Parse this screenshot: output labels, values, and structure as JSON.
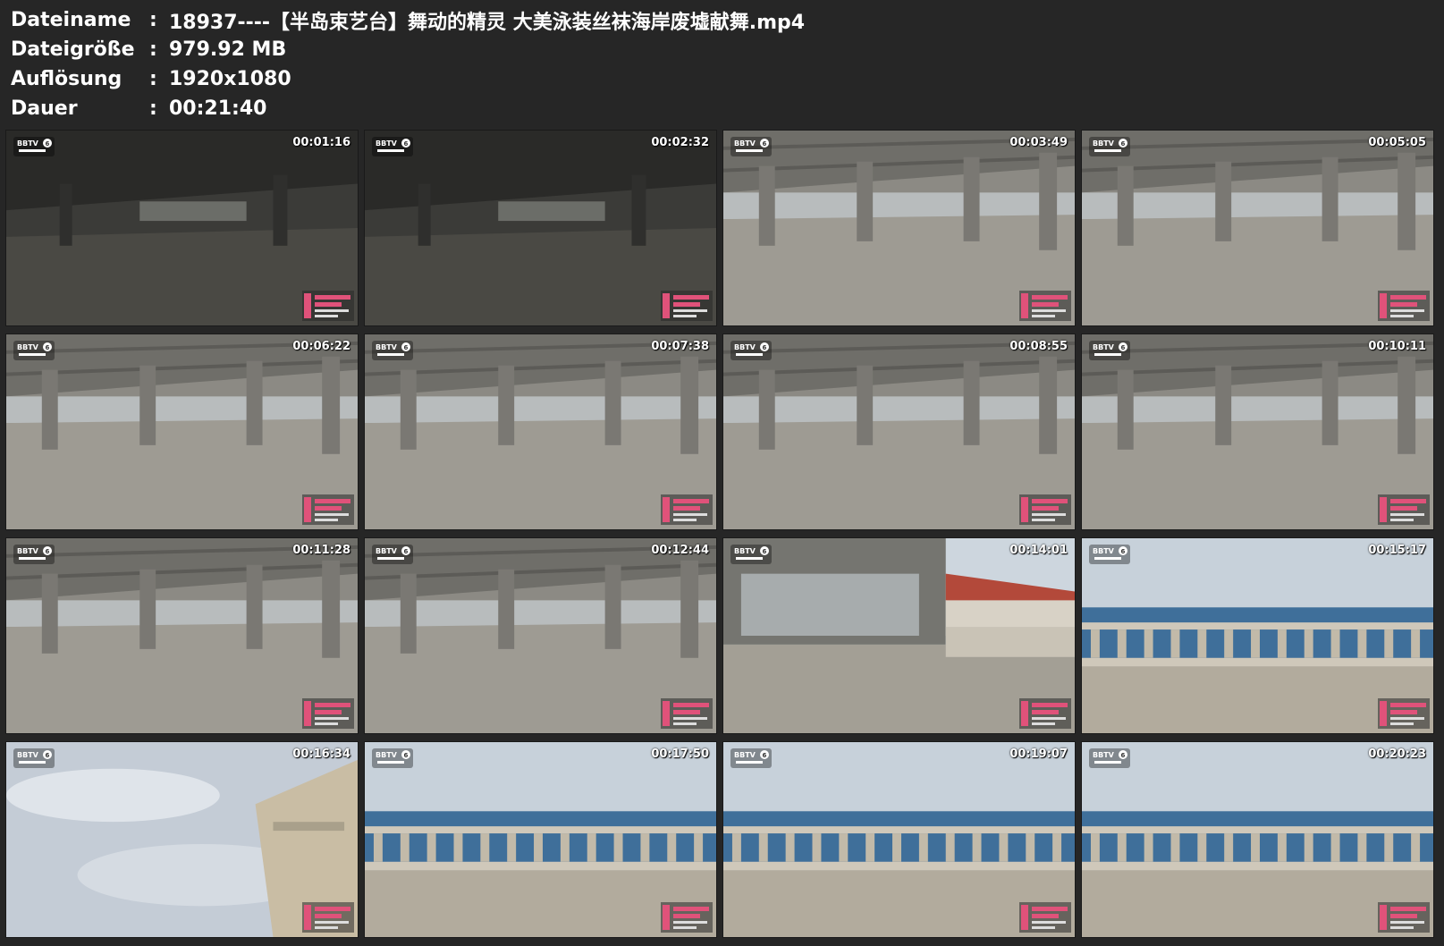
{
  "file_info": {
    "rows": [
      {
        "label": "Dateiname",
        "value": "18937----【半岛束艺台】舞动的精灵 大美泳装丝袜海岸废墟献舞.mp4"
      },
      {
        "label": "Dateigröße",
        "value": "979.92 MB"
      },
      {
        "label": "Auflösung",
        "value": "1920x1080"
      },
      {
        "label": "Dauer",
        "value": "00:21:40"
      }
    ],
    "separator": ":"
  },
  "thumbnails": [
    {
      "timestamp": "00:01:16",
      "scene": "indoor-dark"
    },
    {
      "timestamp": "00:02:32",
      "scene": "indoor-dark"
    },
    {
      "timestamp": "00:03:49",
      "scene": "indoor"
    },
    {
      "timestamp": "00:05:05",
      "scene": "indoor"
    },
    {
      "timestamp": "00:06:22",
      "scene": "indoor"
    },
    {
      "timestamp": "00:07:38",
      "scene": "indoor"
    },
    {
      "timestamp": "00:08:55",
      "scene": "indoor"
    },
    {
      "timestamp": "00:10:11",
      "scene": "indoor"
    },
    {
      "timestamp": "00:11:28",
      "scene": "indoor"
    },
    {
      "timestamp": "00:12:44",
      "scene": "indoor"
    },
    {
      "timestamp": "00:14:01",
      "scene": "terrace"
    },
    {
      "timestamp": "00:15:17",
      "scene": "seaside"
    },
    {
      "timestamp": "00:16:34",
      "scene": "sky"
    },
    {
      "timestamp": "00:17:50",
      "scene": "seaside"
    },
    {
      "timestamp": "00:19:07",
      "scene": "seaside"
    },
    {
      "timestamp": "00:20:23",
      "scene": "seaside"
    }
  ],
  "colors": {
    "background": "#262626",
    "text": "#ffffff",
    "concrete": "#8a8a84",
    "sky": "#c9d3dc",
    "sea": "#3f6f9a",
    "studio_accent": "#e0527a"
  },
  "icons": [
    "channel-logo-icon",
    "studio-watermark-icon"
  ]
}
